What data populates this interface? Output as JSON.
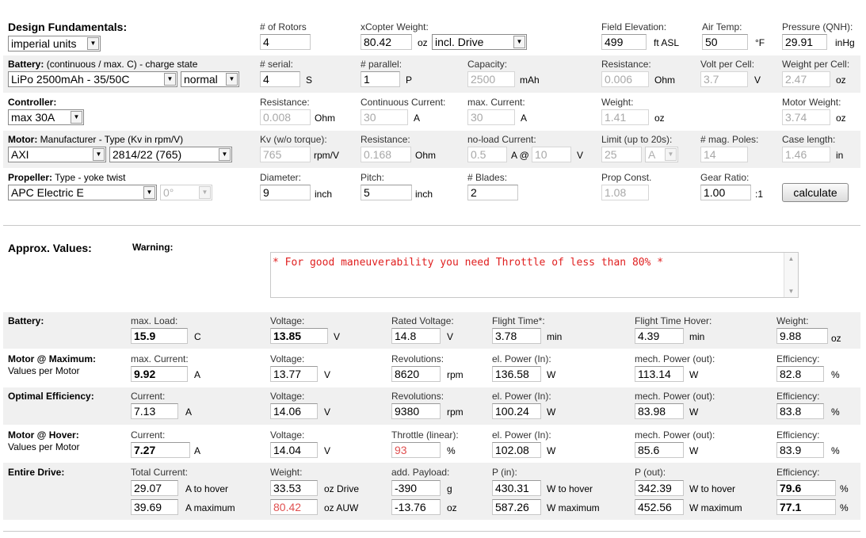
{
  "top": {
    "design_title": "Design Fundamentals:",
    "units_select": "imperial units",
    "rotors_label": "# of Rotors",
    "rotors_value": "4",
    "weight_label": "xCopter Weight:",
    "weight_value": "80.42",
    "weight_unit": "oz",
    "weight_mode": "incl. Drive",
    "elev_label": "Field Elevation:",
    "elev_value": "499",
    "elev_unit": "ft ASL",
    "temp_label": "Air Temp:",
    "temp_value": "50",
    "temp_unit": "°F",
    "pressure_label": "Pressure (QNH):",
    "pressure_value": "29.91",
    "pressure_unit": "inHg"
  },
  "battery": {
    "title": "Battery:",
    "subtitle": " (continuous / max. C) - charge state",
    "type_select": "LiPo 2500mAh - 35/50C",
    "state_select": "normal",
    "serial_label": "# serial:",
    "serial_value": "4",
    "serial_unit": "S",
    "parallel_label": "# parallel:",
    "parallel_value": "1",
    "parallel_unit": "P",
    "capacity_label": "Capacity:",
    "capacity_value": "2500",
    "capacity_unit": "mAh",
    "resistance_label": "Resistance:",
    "resistance_value": "0.006",
    "resistance_unit": "Ohm",
    "volt_label": "Volt per Cell:",
    "volt_value": "3.7",
    "volt_unit": "V",
    "wpc_label": "Weight per Cell:",
    "wpc_value": "2.47",
    "wpc_unit": "oz"
  },
  "controller": {
    "title": "Controller:",
    "select": "max 30A",
    "resistance_label": "Resistance:",
    "resistance_value": "0.008",
    "resistance_unit": "Ohm",
    "cont_label": "Continuous Current:",
    "cont_value": "30",
    "cont_unit": "A",
    "max_label": "max. Current:",
    "max_value": "30",
    "max_unit": "A",
    "weight_label": "Weight:",
    "weight_value": "1.41",
    "weight_unit": "oz",
    "motor_weight_label": "Motor Weight:",
    "motor_weight_value": "3.74",
    "motor_weight_unit": "oz"
  },
  "motor": {
    "title": "Motor:",
    "subtitle": " Manufacturer - Type (Kv in rpm/V)",
    "manufacturer": "AXI",
    "type": "2814/22 (765)",
    "kv_label": "Kv (w/o torque):",
    "kv_value": "765",
    "kv_unit": "rpm/V",
    "res_label": "Resistance:",
    "res_value": "0.168",
    "res_unit": "Ohm",
    "noload_label": "no-load Current:",
    "noload_value": "0.5",
    "noload_unit": "A @",
    "noload_v": "10",
    "noload_v_unit": "V",
    "limit_label": "Limit (up to 20s):",
    "limit_value": "25",
    "limit_unit": "A",
    "poles_label": "# mag. Poles:",
    "poles_value": "14",
    "case_label": "Case length:",
    "case_value": "1.46",
    "case_unit": "in"
  },
  "propeller": {
    "title": "Propeller:",
    "subtitle": " Type - yoke twist",
    "type": "APC Electric E",
    "twist": "0°",
    "diameter_label": "Diameter:",
    "diameter_value": "9",
    "diameter_unit": "inch",
    "pitch_label": "Pitch:",
    "pitch_value": "5",
    "pitch_unit": "inch",
    "blades_label": "# Blades:",
    "blades_value": "2",
    "const_label": "Prop Const.",
    "const_value": "1.08",
    "gear_label": "Gear Ratio:",
    "gear_value": "1.00",
    "gear_unit": ":1",
    "calc_button": "calculate"
  },
  "approx": {
    "title": "Approx. Values:",
    "warning_label": "Warning:",
    "warning_text": "* For good maneuverability you need Throttle of less than 80% *"
  },
  "results": {
    "battery": {
      "title": "Battery:",
      "load_label": "max. Load:",
      "load_value": "15.9",
      "load_unit": "C",
      "voltage_label": "Voltage:",
      "voltage_value": "13.85",
      "voltage_unit": "V",
      "rated_label": "Rated Voltage:",
      "rated_value": "14.8",
      "rated_unit": "V",
      "flight_label": "Flight Time*:",
      "flight_value": "3.78",
      "flight_unit": "min",
      "hover_label": "Flight Time Hover:",
      "hover_value": "4.39",
      "hover_unit": "min",
      "weight_label": "Weight:",
      "weight_value": "9.88",
      "weight_unit": "oz"
    },
    "motor_max": {
      "title": "Motor @ Maximum:",
      "subtitle": "Values per Motor",
      "current_label": "max. Current:",
      "current_value": "9.92",
      "current_unit": "A",
      "voltage_label": "Voltage:",
      "voltage_value": "13.77",
      "voltage_unit": "V",
      "rev_label": "Revolutions:",
      "rev_value": "8620",
      "rev_unit": "rpm",
      "power_in_label": "el. Power (In):",
      "power_in_value": "136.58",
      "power_in_unit": "W",
      "power_out_label": "mech. Power (out):",
      "power_out_value": "113.14",
      "power_out_unit": "W",
      "eff_label": "Efficiency:",
      "eff_value": "82.8",
      "eff_unit": "%"
    },
    "optimal": {
      "title": "Optimal Efficiency:",
      "current_label": "Current:",
      "current_value": "7.13",
      "current_unit": "A",
      "voltage_label": "Voltage:",
      "voltage_value": "14.06",
      "voltage_unit": "V",
      "rev_label": "Revolutions:",
      "rev_value": "9380",
      "rev_unit": "rpm",
      "power_in_label": "el. Power (In):",
      "power_in_value": "100.24",
      "power_in_unit": "W",
      "power_out_label": "mech. Power (out):",
      "power_out_value": "83.98",
      "power_out_unit": "W",
      "eff_label": "Efficiency:",
      "eff_value": "83.8",
      "eff_unit": "%"
    },
    "hover": {
      "title": "Motor @ Hover:",
      "subtitle": "Values per Motor",
      "current_label": "Current:",
      "current_value": "7.27",
      "current_unit": "A",
      "voltage_label": "Voltage:",
      "voltage_value": "14.04",
      "voltage_unit": "V",
      "throttle_label": "Throttle (linear):",
      "throttle_value": "93",
      "throttle_unit": "%",
      "power_in_label": "el. Power (In):",
      "power_in_value": "102.08",
      "power_in_unit": "W",
      "power_out_label": "mech. Power (out):",
      "power_out_value": "85.6",
      "power_out_unit": "W",
      "eff_label": "Efficiency:",
      "eff_value": "83.9",
      "eff_unit": "%"
    },
    "drive": {
      "title": "Entire Drive:",
      "current_label": "Total Current:",
      "current_hover": "29.07",
      "current_hover_unit": "A to hover",
      "current_max": "39.69",
      "current_max_unit": "A maximum",
      "weight_label": "Weight:",
      "weight_drive": "33.53",
      "weight_drive_unit": "oz Drive",
      "weight_auw": "80.42",
      "weight_auw_unit": "oz AUW",
      "payload_label": "add. Payload:",
      "payload_g": "-390",
      "payload_g_unit": "g",
      "payload_oz": "-13.76",
      "payload_oz_unit": "oz",
      "pin_label": "P (in):",
      "pin_hover": "430.31",
      "pin_hover_unit": "W to hover",
      "pin_max": "587.26",
      "pin_max_unit": "W maximum",
      "pout_label": "P (out):",
      "pout_hover": "342.39",
      "pout_hover_unit": "W to hover",
      "pout_max": "452.56",
      "pout_max_unit": "W maximum",
      "eff_label": "Efficiency:",
      "eff_hover": "79.6",
      "eff_max": "77.1",
      "eff_unit": "%"
    }
  }
}
